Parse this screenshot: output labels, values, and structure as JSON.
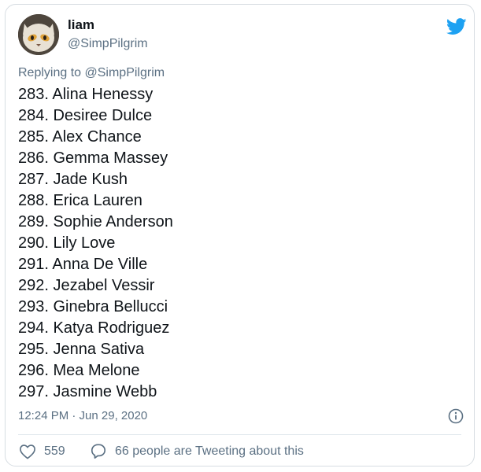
{
  "user": {
    "name": "liam",
    "handle": "@SimpPilgrim"
  },
  "reply": {
    "prefix": "Replying to",
    "mention": "@SimpPilgrim"
  },
  "list_items": [
    "283. Alina Henessy",
    "284. Desiree Dulce",
    "285. Alex Chance",
    "286. Gemma Massey",
    "287. Jade Kush",
    "288. Erica Lauren",
    "289. Sophie Anderson",
    "290. Lily Love",
    "291. Anna De Ville",
    "292. Jezabel Vessir",
    "293. Ginebra Bellucci",
    "294. Katya Rodriguez",
    "295. Jenna Sativa",
    "296. Mea Melone",
    "297. Jasmine Webb"
  ],
  "timestamp": "12:24 PM · Jun 29, 2020",
  "actions": {
    "like_count": "559",
    "tweeting_text": "66 people are Tweeting about this"
  },
  "icons": {
    "brand": "twitter-bird-icon",
    "info": "info-icon",
    "like": "heart-icon",
    "comment": "speech-bubble-icon"
  },
  "colors": {
    "twitter_blue": "#1da1f2",
    "secondary_text": "#5b7083",
    "primary_text": "#0f1419",
    "border": "#d7dde2"
  }
}
